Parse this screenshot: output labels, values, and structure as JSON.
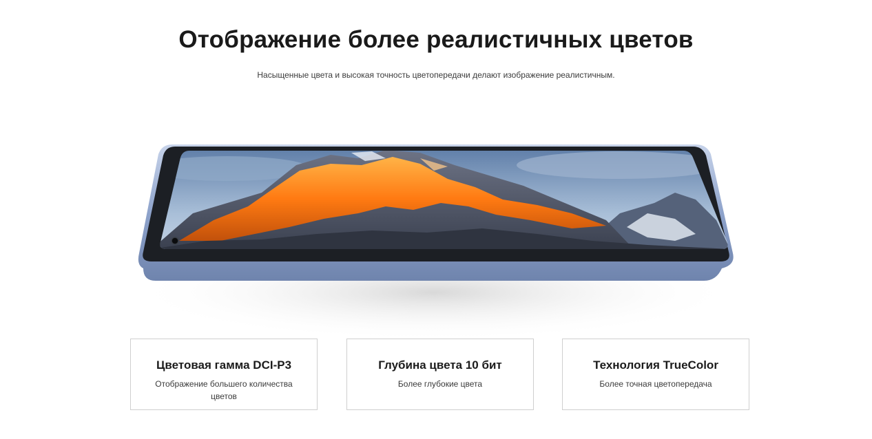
{
  "header": {
    "title": "Отображение более реалистичных цветов",
    "subtitle": "Насыщенные цвета и высокая точность цветопередачи делают изображение реалистичным."
  },
  "features": [
    {
      "title": "Цветовая гамма DCI-P3",
      "description": "Отображение большего количества цветов"
    },
    {
      "title": "Глубина цвета 10 бит",
      "description": "Более глубокие цвета"
    },
    {
      "title": "Технология TrueColor",
      "description": "Более точная цветопередача"
    }
  ],
  "colors": {
    "frame": "#8fa4c9",
    "bezel": "#1c1f24",
    "sky": "#7fa0c4",
    "mountain_lit": "#ff8a1a",
    "mountain_shadow": "#4e5667"
  }
}
